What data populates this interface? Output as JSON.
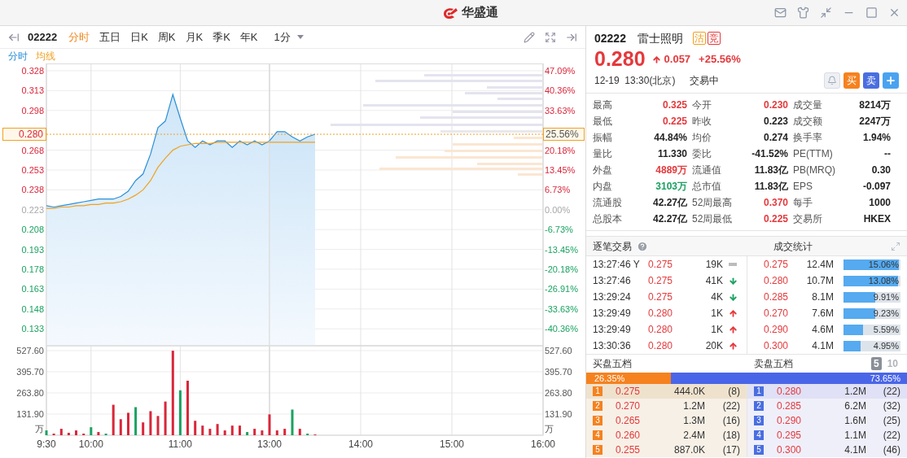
{
  "app": {
    "brand": "华盛通"
  },
  "toolbar": {
    "code": "02222",
    "periods": [
      {
        "label": "分时",
        "selected": true
      },
      {
        "label": "五日",
        "selected": false
      },
      {
        "label": "日K",
        "selected": false
      },
      {
        "label": "周K",
        "selected": false
      },
      {
        "label": "月K",
        "selected": false
      },
      {
        "label": "季K",
        "selected": false
      },
      {
        "label": "年K",
        "selected": false
      }
    ],
    "interval": "1分"
  },
  "chart": {
    "current": {
      "price": "0.280",
      "percent": "25.56%"
    },
    "percent_labels": [
      {
        "text": "47.09%",
        "color": "#d9263a"
      },
      {
        "text": "40.36%",
        "color": "#d9263a"
      },
      {
        "text": "33.63%",
        "color": "#d9263a"
      },
      {
        "text": "20.18%",
        "color": "#d9263a"
      },
      {
        "text": "13.45%",
        "color": "#d9263a"
      },
      {
        "text": "6.73%",
        "color": "#d9263a"
      },
      {
        "text": "0.00%",
        "color": "#a8a8a8"
      },
      {
        "text": "-6.73%",
        "color": "#1aa260"
      },
      {
        "text": "-13.45%",
        "color": "#1aa260"
      },
      {
        "text": "-20.18%",
        "color": "#1aa260"
      },
      {
        "text": "-26.91%",
        "color": "#1aa260"
      },
      {
        "text": "-33.63%",
        "color": "#1aa260"
      },
      {
        "text": "-40.36%",
        "color": "#1aa260"
      }
    ],
    "price_chart": {
      "morning": {
        "chart_data": {
          "type": "line",
          "x": [
            9.5,
            9.583,
            9.667,
            9.75,
            9.833,
            9.917,
            10,
            10.083,
            10.167,
            10.25,
            10.333,
            10.417,
            10.5,
            10.583,
            10.667,
            10.75,
            10.833,
            10.917,
            11,
            11.083,
            11.167,
            11.25,
            11.333,
            11.417,
            11.5,
            11.583,
            11.667,
            11.75,
            11.833,
            11.917,
            12
          ],
          "xlim": [
            9.5,
            12
          ],
          "ylim": [
            0.1202,
            0.3335
          ],
          "yticks": [
            {
              "value": 0.328,
              "label": "0.328"
            },
            {
              "value": 0.313,
              "label": "0.313"
            },
            {
              "value": 0.298,
              "label": "0.298"
            },
            {
              "value": 0.268,
              "label": "0.268"
            },
            {
              "value": 0.253,
              "label": "0.253"
            },
            {
              "value": 0.238,
              "label": "0.238"
            },
            {
              "value": 0.223,
              "label": "0.223"
            },
            {
              "value": 0.208,
              "label": "0.208"
            },
            {
              "value": 0.193,
              "label": "0.193"
            },
            {
              "value": 0.178,
              "label": "0.178"
            },
            {
              "value": 0.163,
              "label": "0.163"
            },
            {
              "value": 0.148,
              "label": "0.148"
            },
            {
              "value": 0.133,
              "label": "0.133"
            }
          ],
          "series": [
            {
              "name": "分时",
              "color": "#2a8fd8",
              "values": [
                0.226,
                0.225,
                0.226,
                0.227,
                0.228,
                0.229,
                0.23,
                0.231,
                0.231,
                0.231,
                0.233,
                0.237,
                0.245,
                0.25,
                0.265,
                0.285,
                0.29,
                0.31,
                0.292,
                0.275,
                0.27,
                0.275,
                0.272,
                0.275,
                0.275,
                0.27,
                0.275,
                0.272,
                0.275,
                0.272,
                0.275
              ]
            },
            {
              "name": "均线",
              "color": "#f0a020",
              "values": [
                0.224,
                0.224,
                0.225,
                0.225,
                0.226,
                0.226,
                0.227,
                0.227,
                0.228,
                0.228,
                0.229,
                0.231,
                0.234,
                0.238,
                0.245,
                0.255,
                0.262,
                0.268,
                0.271,
                0.272,
                0.273,
                0.273,
                0.273,
                0.274,
                0.274,
                0.274,
                0.274,
                0.274,
                0.274,
                0.274,
                0.274
              ]
            }
          ]
        }
      },
      "afternoon": {
        "chart_data": {
          "type": "line",
          "x": [
            13,
            13.083,
            13.167,
            13.25,
            13.333,
            13.417,
            13.5
          ],
          "xlim": [
            13,
            16
          ],
          "ylim": [
            0.1202,
            0.3335
          ],
          "series": [
            {
              "color": "#2a8fd8",
              "values": [
                0.275,
                0.282,
                0.282,
                0.278,
                0.275,
                0.278,
                0.28
              ]
            },
            {
              "color": "#f0a020",
              "values": [
                0.274,
                0.274,
                0.274,
                0.274,
                0.274,
                0.274,
                0.274
              ]
            }
          ]
        }
      }
    },
    "volume_chart": {
      "morning": {
        "chart_data": {
          "type": "bar",
          "x": [
            9.5,
            9.583,
            9.667,
            9.75,
            9.833,
            9.917,
            10,
            10.083,
            10.167,
            10.25,
            10.333,
            10.417,
            10.5,
            10.583,
            10.667,
            10.75,
            10.833,
            10.917,
            11,
            11.083,
            11.167,
            11.25,
            11.333,
            11.417,
            11.5,
            11.583,
            11.667,
            11.75,
            11.833,
            11.917
          ],
          "xlim": [
            9.5,
            12
          ],
          "ylim": [
            0,
            558
          ],
          "xticks": [
            {
              "value": 9.5,
              "label": "9:30"
            },
            {
              "value": 10,
              "label": "10:00"
            },
            {
              "value": 11,
              "label": "11:00"
            }
          ],
          "yticks": [
            {
              "value": 527.6,
              "label": "527.60"
            },
            {
              "value": 395.7,
              "label": "395.70"
            },
            {
              "value": 263.8,
              "label": "263.80"
            },
            {
              "value": 131.9,
              "label": "131.90"
            }
          ],
          "series": [
            {
              "color": "#d9263a",
              "values": [
                null,
                10,
                40,
                15,
                30,
                10,
                null,
                20,
                null,
                190,
                100,
                140,
                null,
                80,
                150,
                120,
                210,
                527,
                null,
                340,
                90,
                60,
                40,
                70,
                30,
                60,
                60,
                null,
                40,
                30
              ]
            },
            {
              "color": "#1aa260",
              "values": [
                30,
                null,
                null,
                null,
                null,
                null,
                50,
                null,
                10,
                null,
                null,
                null,
                175,
                null,
                null,
                null,
                null,
                null,
                280,
                null,
                null,
                null,
                null,
                null,
                null,
                null,
                null,
                20,
                null,
                null
              ]
            }
          ]
        }
      },
      "afternoon": {
        "chart_data": {
          "type": "bar",
          "x": [
            13,
            13.083,
            13.167,
            13.25,
            13.333,
            13.417,
            13.5
          ],
          "xlim": [
            13,
            16
          ],
          "ylim": [
            0,
            558
          ],
          "xticks": [
            {
              "value": 13,
              "label": "13:00"
            },
            {
              "value": 14,
              "label": "14:00"
            },
            {
              "value": 15,
              "label": "15:00"
            },
            {
              "value": 16,
              "label": "16:00"
            }
          ],
          "yticks": [
            {
              "value": 527.6,
              "label": "527.60"
            },
            {
              "value": 395.7,
              "label": "395.70"
            },
            {
              "value": 263.8,
              "label": "263.80"
            },
            {
              "value": 131.9,
              "label": "131.90"
            }
          ],
          "series": [
            {
              "color": "#d9263a",
              "values": [
                130,
                30,
                40,
                null,
                40,
                null,
                5
              ]
            },
            {
              "color": "#1aa260",
              "values": [
                null,
                null,
                null,
                160,
                null,
                10,
                null
              ]
            }
          ]
        }
      }
    },
    "volume_unit_left": "万",
    "volume_unit_right": "万"
  },
  "quote": {
    "code": "02222",
    "name": "雷士照明",
    "badges": [
      {
        "text": "沽",
        "color": "#f0a020"
      },
      {
        "text": "竞",
        "color": "#e4393c"
      }
    ],
    "price": "0.280",
    "kind": "up",
    "change": "0.057",
    "change_pct": "+25.56%",
    "time": "12-19  13:30(北京)",
    "status": "交易中",
    "actions": [
      {
        "kind": "bell"
      },
      {
        "kind": "buy",
        "label": "买"
      },
      {
        "kind": "sell",
        "label": "卖"
      },
      {
        "kind": "add"
      }
    ]
  },
  "stats": [
    {
      "label": "最高",
      "value": "0.325",
      "color": "#e4393c"
    },
    {
      "label": "今开",
      "value": "0.230",
      "color": "#e4393c"
    },
    {
      "label": "成交量",
      "value": "8214万",
      "color": "#222222"
    },
    {
      "label": "最低",
      "value": "0.225",
      "color": "#e4393c"
    },
    {
      "label": "昨收",
      "value": "0.223",
      "color": "#222222"
    },
    {
      "label": "成交额",
      "value": "2247万",
      "color": "#222222"
    },
    {
      "label": "振幅",
      "value": "44.84%",
      "color": "#222222"
    },
    {
      "label": "均价",
      "value": "0.274",
      "color": "#222222"
    },
    {
      "label": "换手率",
      "value": "1.94%",
      "color": "#222222"
    },
    {
      "label": "量比",
      "value": "11.330",
      "color": "#222222"
    },
    {
      "label": "委比",
      "value": "-41.52%",
      "color": "#222222"
    },
    {
      "label": "PE(TTM)",
      "value": "--",
      "color": "#222222"
    },
    {
      "label": "外盘",
      "value": "4889万",
      "color": "#e4393c"
    },
    {
      "label": "流通值",
      "value": "11.83亿",
      "color": "#222222"
    },
    {
      "label": "PB(MRQ)",
      "value": "0.30",
      "color": "#222222"
    },
    {
      "label": "内盘",
      "value": "3103万",
      "color": "#1aa260"
    },
    {
      "label": "总市值",
      "value": "11.83亿",
      "color": "#222222"
    },
    {
      "label": "EPS",
      "value": "-0.097",
      "color": "#222222"
    },
    {
      "label": "流通股",
      "value": "42.27亿",
      "color": "#222222"
    },
    {
      "label": "52周最高",
      "value": "0.370",
      "color": "#e4393c"
    },
    {
      "label": "每手",
      "value": "1000",
      "color": "#222222"
    },
    {
      "label": "总股本",
      "value": "42.27亿",
      "color": "#222222"
    },
    {
      "label": "52周最低",
      "value": "0.225",
      "color": "#e4393c"
    },
    {
      "label": "交易所",
      "value": "HKEX",
      "color": "#222222"
    }
  ],
  "trades": {
    "title": "逐笔交易",
    "stats_title": "成交统计",
    "rows": [
      {
        "time": "13:27:46 Y",
        "price": "0.275",
        "volume": "19K",
        "kind": "flat"
      },
      {
        "time": "13:27:46",
        "price": "0.275",
        "volume": "41K",
        "kind": "down"
      },
      {
        "time": "13:29:24",
        "price": "0.275",
        "volume": "4K",
        "kind": "down"
      },
      {
        "time": "13:29:49",
        "price": "0.280",
        "volume": "1K",
        "kind": "up"
      },
      {
        "time": "13:29:49",
        "price": "0.280",
        "volume": "1K",
        "kind": "up"
      },
      {
        "time": "13:30:36",
        "price": "0.280",
        "volume": "20K",
        "kind": "up"
      }
    ],
    "stats_rows": [
      {
        "price": "0.275",
        "volume": "12.4M",
        "level": 0.97,
        "share": "15.06%"
      },
      {
        "price": "0.280",
        "volume": "10.7M",
        "level": 0.96,
        "share": "13.08%"
      },
      {
        "price": "0.285",
        "volume": "8.1M",
        "level": 0.56,
        "share": "9.91%"
      },
      {
        "price": "0.270",
        "volume": "7.6M",
        "level": 0.55,
        "share": "9.23%"
      },
      {
        "price": "0.290",
        "volume": "4.6M",
        "level": 0.34,
        "share": "5.59%"
      },
      {
        "price": "0.300",
        "volume": "4.1M",
        "level": 0.3,
        "share": "4.95%"
      }
    ]
  },
  "order_book": {
    "bid_title": "买盘五档",
    "ask_title": "卖盘五档",
    "depth_options": [
      {
        "label": "5",
        "selected": true
      },
      {
        "label": "10",
        "selected": false
      }
    ],
    "bid_share": "26.35%",
    "ask_share": "73.65%",
    "level": 0.2635,
    "bids": [
      {
        "index": "1",
        "price": "0.275",
        "volume": "444.0K",
        "count": "(8)",
        "selected": true
      },
      {
        "index": "2",
        "price": "0.270",
        "volume": "1.2M",
        "count": "(22)",
        "selected": false
      },
      {
        "index": "3",
        "price": "0.265",
        "volume": "1.3M",
        "count": "(16)",
        "selected": false
      },
      {
        "index": "4",
        "price": "0.260",
        "volume": "2.4M",
        "count": "(18)",
        "selected": false
      },
      {
        "index": "5",
        "price": "0.255",
        "volume": "887.0K",
        "count": "(17)",
        "selected": false
      }
    ],
    "asks": [
      {
        "index": "1",
        "price": "0.280",
        "volume": "1.2M",
        "count": "(22)",
        "selected": true
      },
      {
        "index": "2",
        "price": "0.285",
        "volume": "6.2M",
        "count": "(32)",
        "selected": false
      },
      {
        "index": "3",
        "price": "0.290",
        "volume": "1.6M",
        "count": "(25)",
        "selected": false
      },
      {
        "index": "4",
        "price": "0.295",
        "volume": "1.1M",
        "count": "(22)",
        "selected": false
      },
      {
        "index": "5",
        "price": "0.300",
        "volume": "4.1M",
        "count": "(46)",
        "selected": false
      }
    ]
  }
}
